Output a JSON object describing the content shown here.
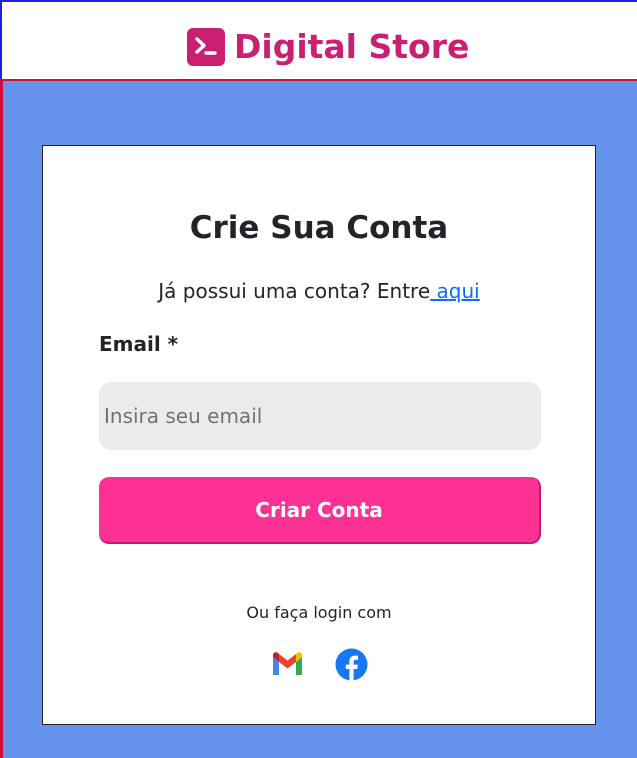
{
  "header": {
    "logo_text": "Digital Store",
    "logo_icon": "terminal-icon",
    "brand_color": "#c92071"
  },
  "form": {
    "title": "Crie Sua Conta",
    "subtitle_prefix": "Já possui uma conta? Entre",
    "subtitle_link": " aqui",
    "email_label": "Email *",
    "email_placeholder": "Insira seu email",
    "email_value": "",
    "submit_label": "Criar Conta",
    "accent_color": "#fd3194"
  },
  "social": {
    "caption": "Ou faça login com",
    "providers": [
      {
        "name": "Gmail",
        "icon": "gmail-icon"
      },
      {
        "name": "Facebook",
        "icon": "facebook-icon"
      }
    ]
  },
  "colors": {
    "background": "#6694ec",
    "card": "#ffffff",
    "link": "#0d6efd"
  }
}
